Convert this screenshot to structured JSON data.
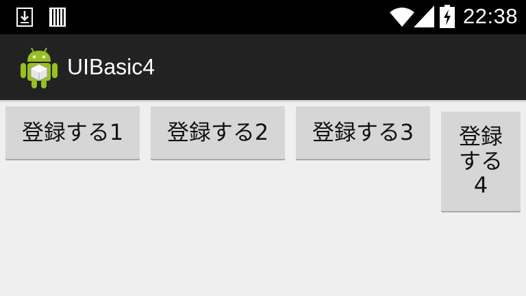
{
  "status_bar": {
    "time": "22:38",
    "icons": [
      "download-icon",
      "storage-bars-icon",
      "wifi-icon",
      "signal-icon",
      "battery-charging-icon"
    ]
  },
  "action_bar": {
    "app_icon": "android-app-icon",
    "title": "UIBasic4"
  },
  "buttons": [
    {
      "label": "登録する1"
    },
    {
      "label": "登録する2"
    },
    {
      "label": "登録する3"
    },
    {
      "label": "登録する4"
    }
  ],
  "colors": {
    "status_bar_bg": "#000000",
    "action_bar_bg": "#222222",
    "content_bg": "#efefef",
    "button_bg": "#d6d6d6"
  }
}
